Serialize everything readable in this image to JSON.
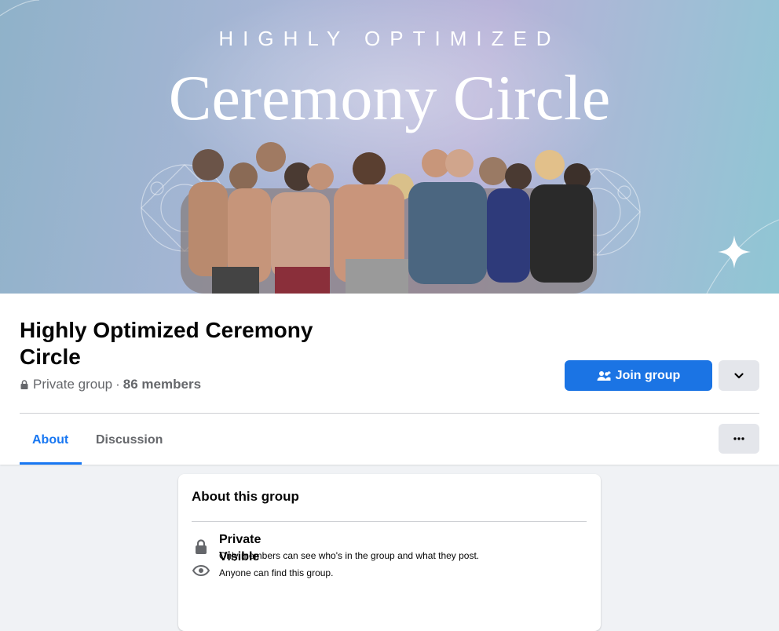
{
  "cover": {
    "kicker": "HIGHLY OPTIMIZED",
    "title": "Ceremony Circle"
  },
  "group": {
    "name": "Highly Optimized Ceremony Circle",
    "privacy": "Private group",
    "separator": "·",
    "members": "86 members"
  },
  "actions": {
    "join_label": "Join group",
    "more_label": "···"
  },
  "tabs": [
    {
      "label": "About",
      "active": true
    },
    {
      "label": "Discussion",
      "active": false
    }
  ],
  "about": {
    "title": "About this group",
    "items": [
      {
        "icon": "lock-icon",
        "title": "Private",
        "description": "Only members can see who's in the group and what they post."
      },
      {
        "icon": "eye-icon",
        "title": "Visible",
        "description": "Anyone can find this group."
      }
    ]
  },
  "colors": {
    "primary": "#1b74e4",
    "active_tab": "#1877f2",
    "secondary_button": "#e4e6eb",
    "page_background": "#f0f2f5",
    "muted_text": "#65676b"
  }
}
